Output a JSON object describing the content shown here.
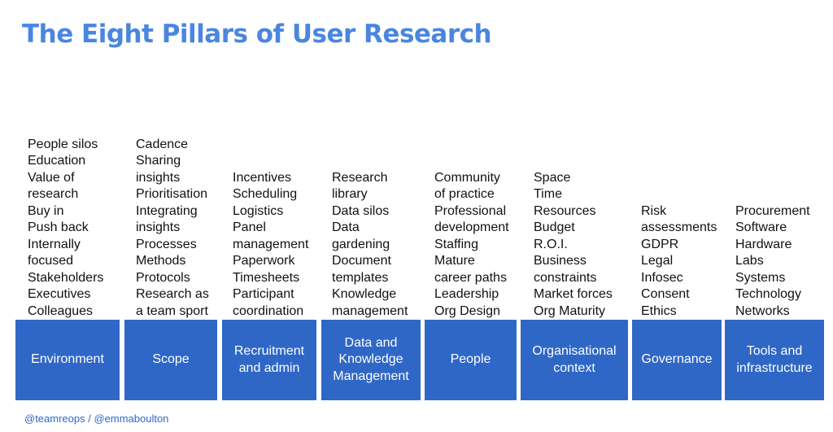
{
  "title": "The Eight Pillars of User Research",
  "accent_color": "#2f67c7",
  "title_color": "#4a86e0",
  "pillars": [
    {
      "name": "Environment",
      "items": [
        "People silos",
        "Education",
        "Value of",
        "research",
        "Buy in",
        "Push back",
        "Internally",
        "focused",
        "Stakeholders",
        "Executives",
        "Colleagues"
      ]
    },
    {
      "name": "Scope",
      "items": [
        "Cadence",
        "Sharing",
        "insights",
        "Prioritisation",
        "Integrating",
        "insights",
        "Processes",
        "Methods",
        "Protocols",
        "Research as",
        "a team sport"
      ]
    },
    {
      "name": "Recruitment\nand admin",
      "items": [
        "Incentives",
        "Scheduling",
        "Logistics",
        "Panel",
        "management",
        "Paperwork",
        "Timesheets",
        "Participant",
        "coordination"
      ]
    },
    {
      "name": "Data and\nKnowledge\nManagement",
      "items": [
        "Research",
        "library",
        "Data silos",
        "Data",
        "gardening",
        "Document",
        "templates",
        "Knowledge",
        "management"
      ]
    },
    {
      "name": "People",
      "items": [
        "Community",
        "of practice",
        "Professional",
        "development",
        "Staffing",
        "Mature",
        "career paths",
        "Leadership",
        "Org Design"
      ]
    },
    {
      "name": "Organisational\ncontext",
      "items": [
        "Space",
        "Time",
        "Resources",
        "Budget",
        "R.O.I.",
        "Business",
        "constraints",
        "Market forces",
        "Org Maturity"
      ]
    },
    {
      "name": "Governance",
      "items": [
        "Risk",
        "assessments",
        "GDPR",
        "Legal",
        "Infosec",
        "Consent",
        "Ethics"
      ]
    },
    {
      "name": "Tools and\ninfrastructure",
      "items": [
        "Procurement",
        "Software",
        "Hardware",
        "Labs",
        "Systems",
        "Technology",
        "Networks"
      ]
    }
  ],
  "credit": "@teamreops / @emmaboulton"
}
